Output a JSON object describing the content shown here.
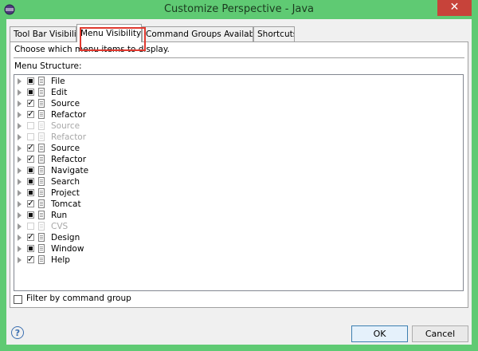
{
  "window": {
    "title": "Customize Perspective - Java",
    "close_symbol": "✕",
    "app_icon": "eclipse-icon"
  },
  "tabs": [
    {
      "label": "Tool Bar Visibility",
      "active": false
    },
    {
      "label": "Menu Visibility",
      "active": true
    },
    {
      "label": "Command Groups Availability",
      "active": false
    },
    {
      "label": "Shortcuts",
      "active": false
    }
  ],
  "panel": {
    "description": "Choose which menu items to display.",
    "structure_label": "Menu Structure:"
  },
  "tree": {
    "items": [
      {
        "label": "File",
        "state": "partial",
        "enabled": true
      },
      {
        "label": "Edit",
        "state": "partial",
        "enabled": true
      },
      {
        "label": "Source",
        "state": "checked",
        "enabled": true
      },
      {
        "label": "Refactor",
        "state": "checked",
        "enabled": true
      },
      {
        "label": "Source",
        "state": "unchecked",
        "enabled": false
      },
      {
        "label": "Refactor",
        "state": "unchecked",
        "enabled": false
      },
      {
        "label": "Source",
        "state": "checked",
        "enabled": true
      },
      {
        "label": "Refactor",
        "state": "checked",
        "enabled": true
      },
      {
        "label": "Navigate",
        "state": "partial",
        "enabled": true
      },
      {
        "label": "Search",
        "state": "partial",
        "enabled": true
      },
      {
        "label": "Project",
        "state": "partial",
        "enabled": true
      },
      {
        "label": "Tomcat",
        "state": "checked",
        "enabled": true
      },
      {
        "label": "Run",
        "state": "partial",
        "enabled": true
      },
      {
        "label": "CVS",
        "state": "unchecked",
        "enabled": false
      },
      {
        "label": "Design",
        "state": "checked",
        "enabled": true
      },
      {
        "label": "Window",
        "state": "partial",
        "enabled": true
      },
      {
        "label": "Help",
        "state": "checked",
        "enabled": true
      }
    ]
  },
  "filter": {
    "label": "Filter by command group",
    "checked": false
  },
  "footer": {
    "help_symbol": "?",
    "ok_label": "OK",
    "cancel_label": "Cancel"
  },
  "colors": {
    "titlebar": "#5fca73",
    "close_button": "#c7433a",
    "highlight": "#e0392f"
  }
}
